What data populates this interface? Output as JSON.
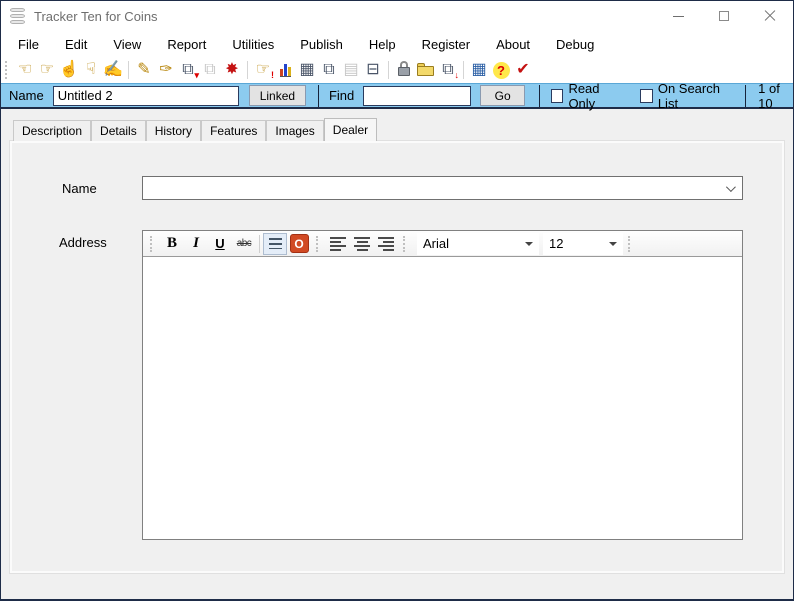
{
  "window": {
    "title": "Tracker Ten for Coins"
  },
  "menu": {
    "items": [
      "File",
      "Edit",
      "View",
      "Report",
      "Utilities",
      "Publish",
      "Help",
      "Register",
      "About",
      "Debug"
    ]
  },
  "toolbar": {
    "icons": [
      {
        "name": "previous-record-icon",
        "glyph": "☜"
      },
      {
        "name": "next-record-icon",
        "glyph": "☞"
      },
      {
        "name": "first-record-icon",
        "glyph": "☝"
      },
      {
        "name": "last-record-icon",
        "glyph": "☟"
      },
      {
        "name": "select-record-icon",
        "glyph": "✍"
      },
      {
        "name": "new-record-icon",
        "glyph": "✎"
      },
      {
        "name": "edit-record-icon",
        "glyph": "✑"
      },
      {
        "name": "save-record-icon",
        "glyph": "⧉",
        "badge": "▾"
      },
      {
        "name": "copy-record-icon",
        "glyph": "⧉"
      },
      {
        "name": "delete-record-icon",
        "glyph": "✸"
      },
      {
        "name": "find-record-icon",
        "glyph": "☞",
        "badge": "!"
      },
      {
        "name": "chart-icon",
        "glyph": ""
      },
      {
        "name": "table-icon",
        "glyph": "▦"
      },
      {
        "name": "copies-icon",
        "glyph": "⧉"
      },
      {
        "name": "film-icon",
        "glyph": "▤"
      },
      {
        "name": "print-icon",
        "glyph": "⊟"
      },
      {
        "name": "lock-icon",
        "glyph": ""
      },
      {
        "name": "open-folder-icon",
        "glyph": ""
      },
      {
        "name": "export-icon",
        "glyph": "⧉",
        "badge": "↓"
      },
      {
        "name": "calculator-icon",
        "glyph": "▦"
      },
      {
        "name": "help-icon",
        "glyph": "?"
      },
      {
        "name": "confirm-icon",
        "glyph": "✔"
      }
    ]
  },
  "record_bar": {
    "name_label": "Name",
    "name_value": "Untitled 2",
    "linked_button": "Linked",
    "find_label": "Find",
    "find_value": "",
    "go_button": "Go",
    "read_only_label": "Read Only",
    "on_search_list_label": "On Search List",
    "position_text": "1 of 10"
  },
  "tabs": {
    "items": [
      "Description",
      "Details",
      "History",
      "Features",
      "Images",
      "Dealer"
    ],
    "active": "Dealer"
  },
  "form": {
    "name_label": "Name",
    "name_value": "",
    "address_label": "Address"
  },
  "editor": {
    "bold_label": "B",
    "italic_label": "I",
    "underline_label": "U",
    "strike_label": "abc",
    "font_value": "Arial",
    "size_value": "12",
    "body_text": ""
  },
  "colors": {
    "record_bar_bg": "#8ccbef",
    "window_border": "#1e2c48",
    "window_bg": "#f0f0f0",
    "editor_accent": "#d14a24"
  }
}
